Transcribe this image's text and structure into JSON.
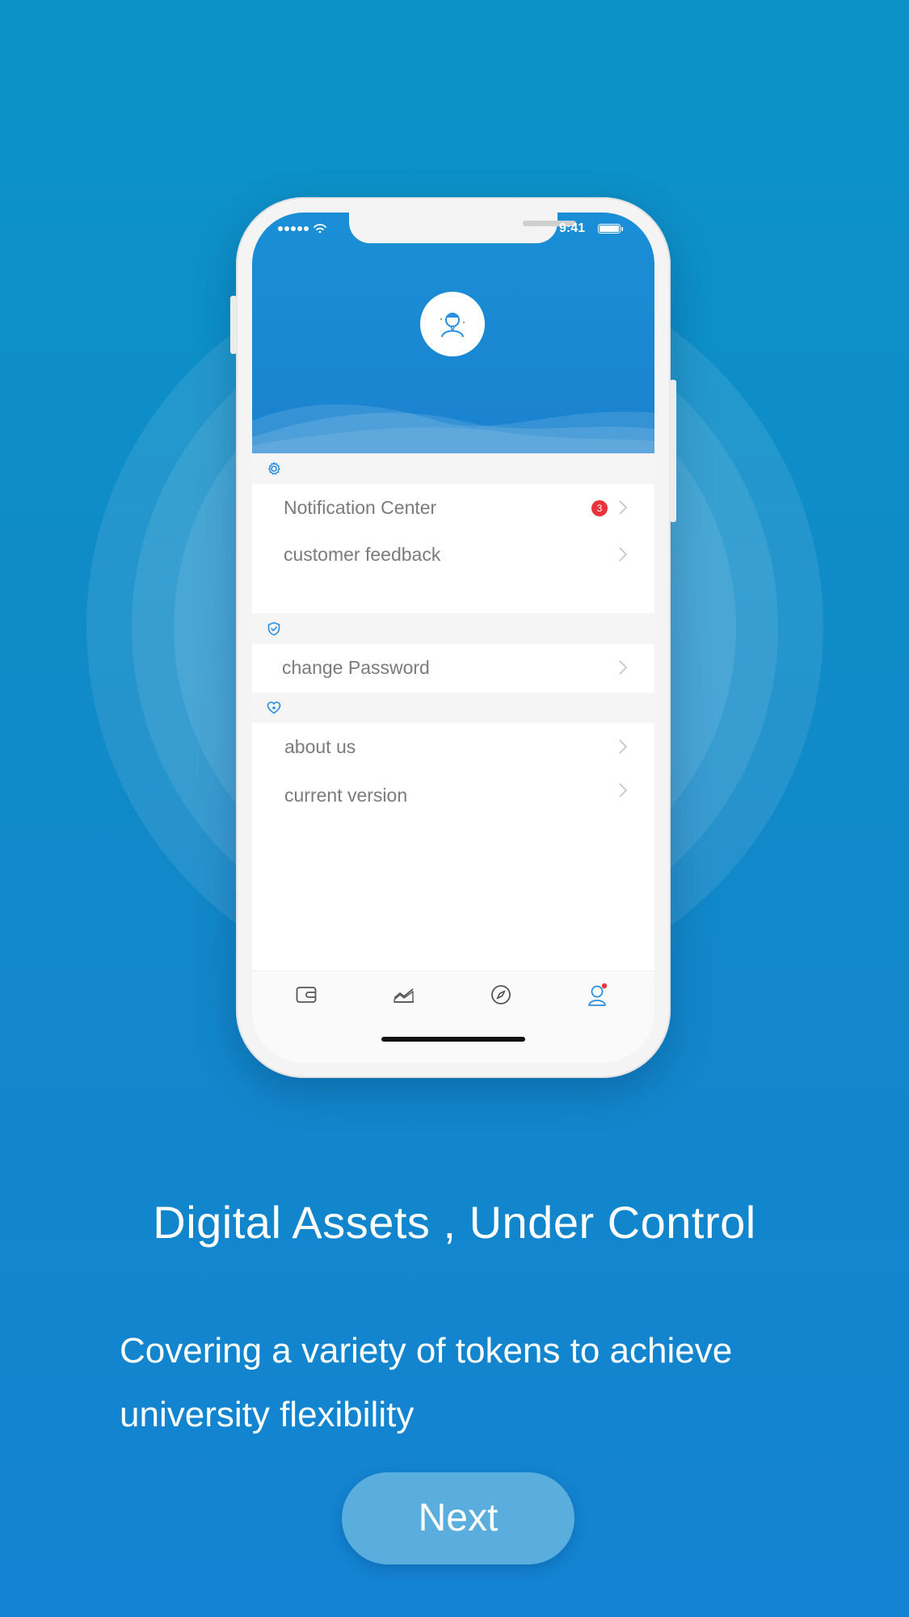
{
  "status_bar": {
    "time": "9:41"
  },
  "menu": {
    "sections": [
      {
        "icon": "gear-icon",
        "items": [
          {
            "label": "Notification Center",
            "badge": "3"
          },
          {
            "label": "customer feedback"
          }
        ]
      },
      {
        "icon": "shield-check-icon",
        "items": [
          {
            "label": "change Password"
          }
        ]
      },
      {
        "icon": "heart-icon",
        "items": [
          {
            "label": "about us"
          },
          {
            "label": "current version"
          }
        ]
      }
    ]
  },
  "tab_bar": {
    "tabs": [
      {
        "icon": "wallet-icon"
      },
      {
        "icon": "market-chart-icon"
      },
      {
        "icon": "compass-icon"
      },
      {
        "icon": "profile-icon",
        "active": true
      }
    ],
    "active_color": "#2a8de0"
  },
  "onboarding": {
    "headline": "Digital Assets , Under Control",
    "description": "Covering a variety of tokens to achieve university flexibility",
    "next_label": "Next"
  },
  "colors": {
    "background_top": "#0b93c7",
    "background_bottom": "#1483d2",
    "header_blue": "#1a8fd6",
    "badge_red": "#e8353c",
    "button": "#5aaede"
  }
}
